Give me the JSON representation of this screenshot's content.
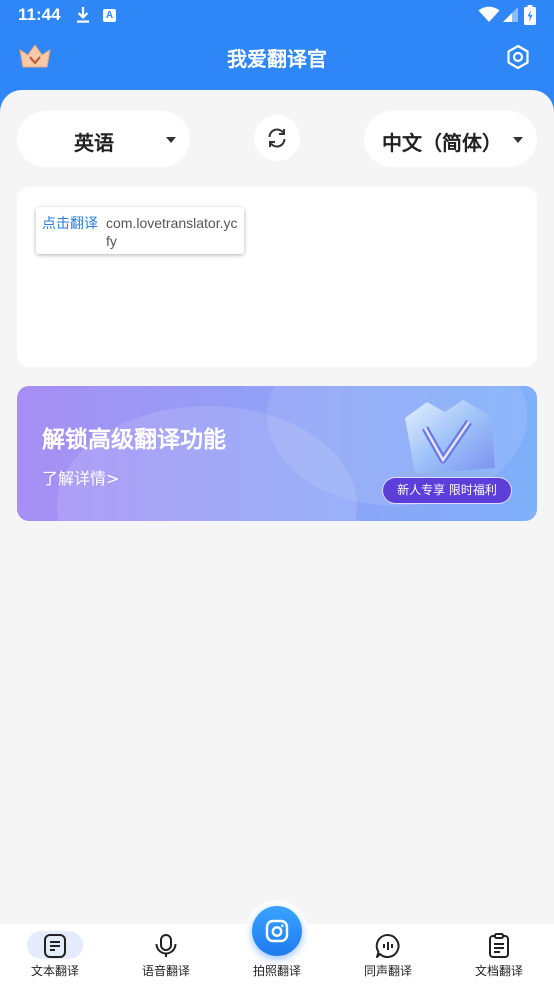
{
  "status_bar": {
    "time": "11:44",
    "notif_badge": "A"
  },
  "app_bar": {
    "title": "我爱翻译官"
  },
  "languages": {
    "source": "英语",
    "target": "中文（简体）"
  },
  "input_popup": {
    "action": "点击翻译",
    "package": "com.lovetranslator.ycfy"
  },
  "banner": {
    "headline": "解锁高级翻译功能",
    "link": "了解详情>",
    "promo": "新人专享 限时福利"
  },
  "tabs": [
    {
      "label": "文本翻译",
      "icon": "text-doc-icon",
      "active": true
    },
    {
      "label": "语音翻译",
      "icon": "microphone-icon",
      "active": false
    },
    {
      "label": "拍照翻译",
      "icon": "camera-icon",
      "active": false
    },
    {
      "label": "同声翻译",
      "icon": "speech-bubble-icon",
      "active": false
    },
    {
      "label": "文档翻译",
      "icon": "clipboard-icon",
      "active": false
    }
  ],
  "colors": {
    "brand": "#2f86f6",
    "background": "#f5f5f6",
    "link": "#2a7de1",
    "promo": "#5b3fd8"
  }
}
